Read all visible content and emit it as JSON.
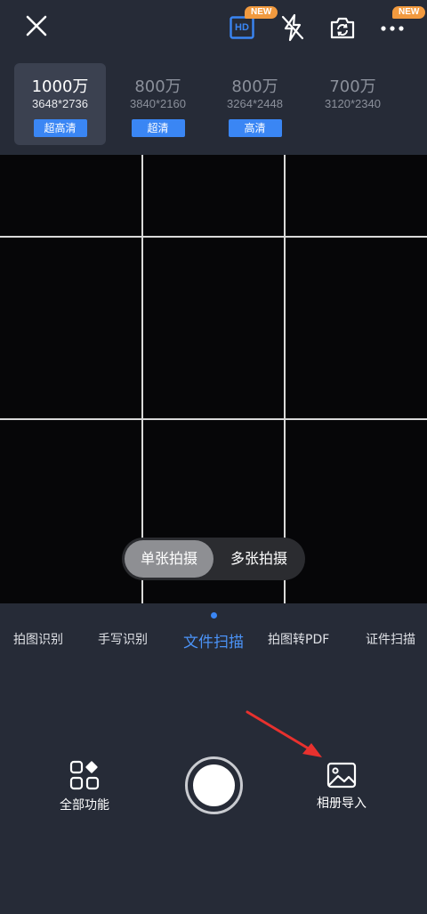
{
  "topbar": {
    "close_icon": "close-icon",
    "hd_label": "HD",
    "hd_badge": "NEW",
    "flash_icon": "flash-off-icon",
    "switch_icon": "camera-switch-icon",
    "more_icon": "more-icon",
    "more_badge": "NEW"
  },
  "resolutions": [
    {
      "mp": "1000万",
      "dims": "3648*2736",
      "tag": "超高清",
      "active": true
    },
    {
      "mp": "800万",
      "dims": "3840*2160",
      "tag": "超清",
      "active": false
    },
    {
      "mp": "800万",
      "dims": "3264*2448",
      "tag": "高清",
      "active": false
    },
    {
      "mp": "700万",
      "dims": "3120*2340",
      "tag": "",
      "active": false
    }
  ],
  "capture_toggle": {
    "single": "单张拍摄",
    "multi": "多张拍摄",
    "selected": "single"
  },
  "modes": [
    {
      "label": "拍图识别"
    },
    {
      "label": "手写识别"
    },
    {
      "label": "文件扫描",
      "active": true
    },
    {
      "label": "拍图转PDF"
    },
    {
      "label": "证件扫描"
    }
  ],
  "bottom": {
    "all_functions": "全部功能",
    "album_import": "相册导入"
  },
  "colors": {
    "accent": "#3a86f4",
    "badge": "#f19a3f",
    "arrow": "#e8312e"
  }
}
